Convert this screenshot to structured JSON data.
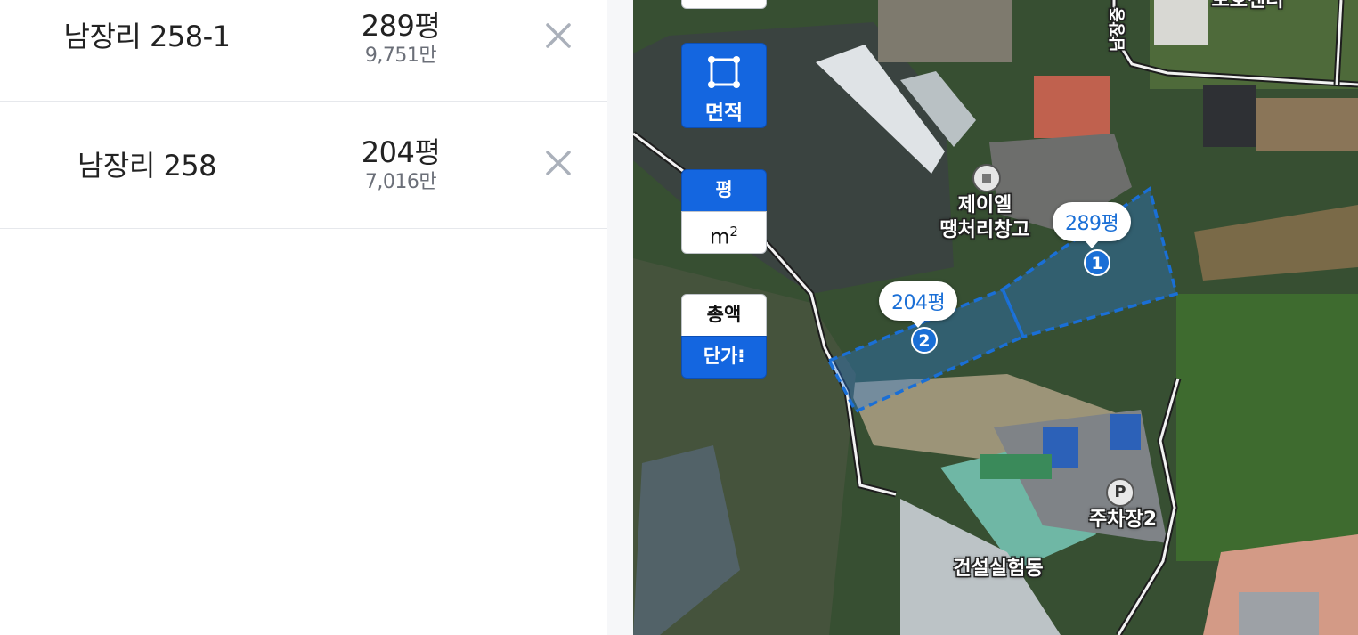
{
  "parcels": [
    {
      "name": "남장리 258-1",
      "area": "289평",
      "price": "9,751만",
      "remove_icon": "close-icon"
    },
    {
      "name": "남장리 258",
      "area": "204평",
      "price": "7,016만",
      "remove_icon": "close-icon"
    }
  ],
  "map_controls": {
    "area_tool_label": "면적",
    "unit_pyeong": "평",
    "unit_m2": "m",
    "unit_m2_sup": "2",
    "total_label": "총액",
    "unit_price_label": "단가",
    "unit_price_more": "⁝"
  },
  "map_labels": {
    "warehouse": [
      "제이엘",
      "땡처리창고"
    ],
    "protection_center_top": "보호센터",
    "road": "남장중",
    "parking": "주차장2",
    "parking_icon": "P",
    "lab_building": "건설실험동"
  },
  "parcel_markers": [
    {
      "number": "1",
      "area_label": "289평"
    },
    {
      "number": "2",
      "area_label": "204평"
    }
  ],
  "colors": {
    "accent_blue": "#1466e0",
    "parcel_fill": "#2a7de1",
    "marker_text": "#1a6fd6"
  }
}
